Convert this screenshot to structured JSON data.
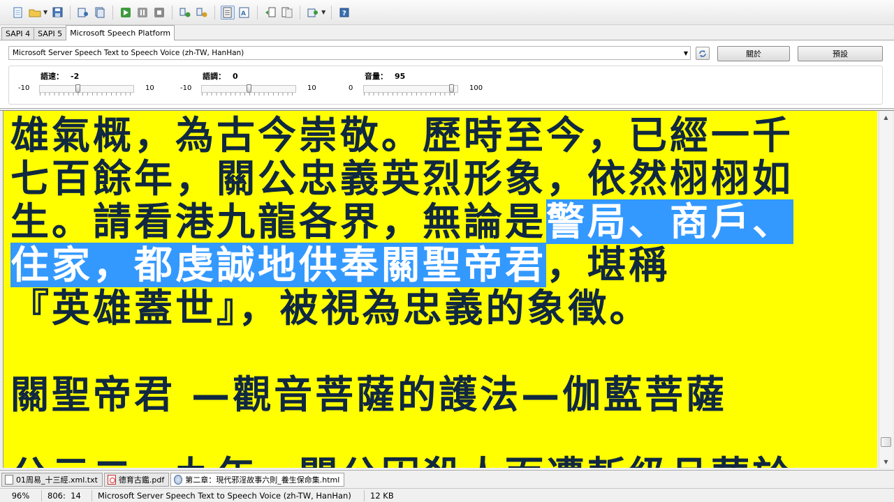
{
  "toolbar": {
    "icons": [
      "new-document-icon",
      "open-folder-icon",
      "save-icon",
      "read-aloud-icon",
      "read-aloud-all-icon",
      "play-icon",
      "pause-icon",
      "stop-icon",
      "convert-icon",
      "convert-mp3-icon",
      "text-view-icon",
      "html-view-icon",
      "page-prev-icon",
      "page-next-icon",
      "settings-icon",
      "help-icon"
    ]
  },
  "engine_tabs": [
    {
      "label": "SAPI 4",
      "active": false
    },
    {
      "label": "SAPI 5",
      "active": false
    },
    {
      "label": "Microsoft Speech Platform",
      "active": true
    }
  ],
  "settings": {
    "voice": "Microsoft Server Speech Text to Speech Voice (zh-TW, HanHan)",
    "about_button": "關於",
    "default_button": "預設",
    "sliders": [
      {
        "label": "語速：",
        "value": "-2",
        "min": "-10",
        "max": "10",
        "fraction": 0.4
      },
      {
        "label": "語調：",
        "value": "0",
        "min": "-10",
        "max": "10",
        "fraction": 0.5
      },
      {
        "label": "音量：",
        "value": "95",
        "min": "0",
        "max": "100",
        "fraction": 0.95
      }
    ]
  },
  "editor": {
    "background": "#ffff00",
    "text_color": "#102840",
    "selection_color": "#3399ff",
    "line1": "雄氣概，為古今崇敬。歷時至今，已經一千",
    "line2": "七百餘年，關公忠義英烈形象，依然栩栩如",
    "line3_plain": "生。請看港九龍各界，無論是",
    "line3_selected": "警局、商戶、",
    "line4_selected": "住家，都虔誠地供奉關聖帝君",
    "line4_plain": "，堪稱",
    "line5": "『英雄蓋世』，被視為忠義的象徵。",
    "line6": "關聖帝君 —觀音菩薩的護法—伽藍菩薩",
    "line7": "公元二一九年，關公因殺人而遭斬級且葬於"
  },
  "document_tabs": [
    {
      "label": "01周易_十三經.xml.txt",
      "type": "txt",
      "active": false
    },
    {
      "label": "德育古鑑.pdf",
      "type": "pdf",
      "active": false
    },
    {
      "label": "第二章：現代邪淫故事六則_養生保命集.html",
      "type": "html",
      "active": true
    }
  ],
  "status": {
    "zoom": "96%",
    "position": "806:  14",
    "voice": "Microsoft Server Speech Text to Speech Voice (zh-TW, HanHan)",
    "size": "12 KB"
  }
}
